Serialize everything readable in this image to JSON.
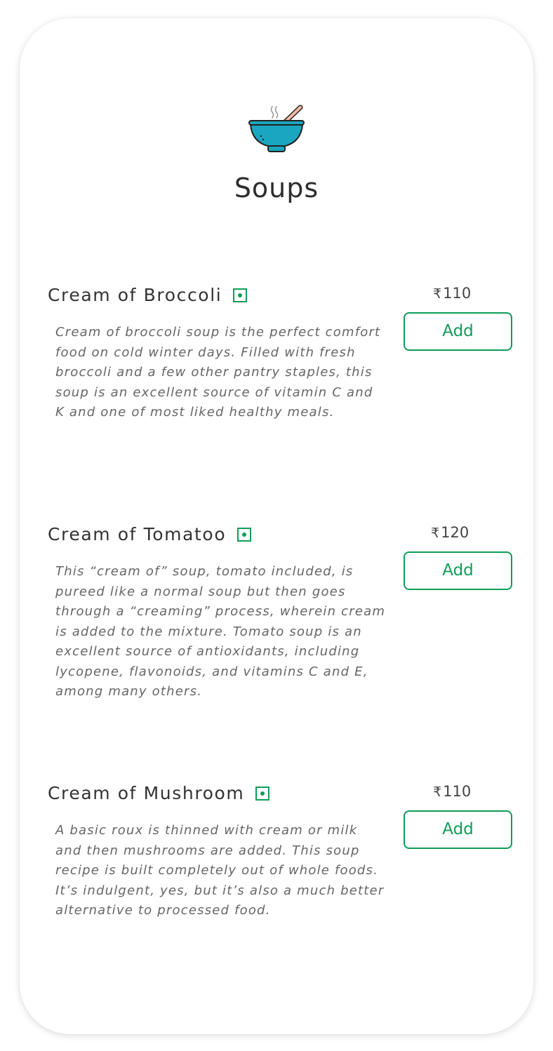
{
  "header": {
    "icon": "soup-bowl-icon",
    "title": "Soups"
  },
  "currency_symbol": "₹",
  "colors": {
    "veg_green": "#0f9d58",
    "bowl_blue": "#1aa6c0",
    "text_dark": "#333333",
    "text_muted": "#666666"
  },
  "items": [
    {
      "name": "Cream of Broccoli",
      "veg": true,
      "price": "110",
      "description": "Cream of broccoli soup is the perfect comfort food on cold winter days. Filled with fresh broccoli and a few other pantry staples, this soup is an excellent source of vitamin C and K and one of most liked healthy meals.",
      "add_label": "Add"
    },
    {
      "name": "Cream of Tomatoo",
      "veg": true,
      "price": "120",
      "description": "This “cream of” soup, tomato included, is pureed like a normal soup but then goes through a “creaming” process, wherein cream is added to the mixture. Tomato soup is an excellent source of antioxidants, including lycopene, flavonoids, and vitamins C and E, among many others.",
      "add_label": "Add"
    },
    {
      "name": "Cream of Mushroom",
      "veg": true,
      "price": "110",
      "description": "A basic roux is thinned with cream or milk and then mushrooms are added. This soup recipe is built completely out of whole foods. It’s indulgent, yes, but it’s also a much better alternative to processed food.",
      "add_label": "Add"
    }
  ]
}
